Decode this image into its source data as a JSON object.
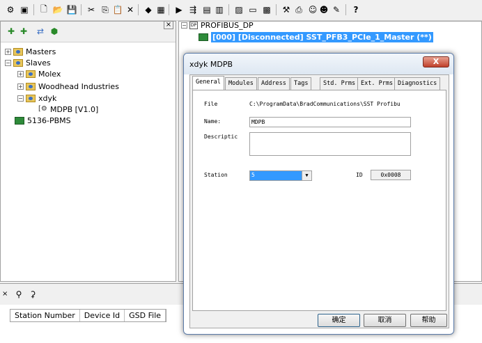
{
  "toolbar": {
    "icons": [
      "network-icon",
      "properties-icon",
      "new-icon",
      "open-icon",
      "save-icon",
      "cut-icon",
      "copy-icon",
      "paste-icon",
      "delete-icon",
      "online-icon",
      "config-icon",
      "download-icon",
      "upload-icon",
      "xml-icon",
      "lsx-icon",
      "monitor-icon",
      "view-icon",
      "device-icon",
      "tool-icon",
      "printer-icon",
      "people-icon",
      "people2-icon",
      "note-icon",
      "help-icon"
    ]
  },
  "left_tree": {
    "masters": "Masters",
    "slaves": "Slaves",
    "molex": "Molex",
    "woodhead": "Woodhead Industries",
    "xdyk": "xdyk",
    "mdpb": "MDPB [V1.0]",
    "pbms": "5136-PBMS"
  },
  "right_tree": {
    "root": "PROFIBUS_DP",
    "master": "[000] [Disconnected] SST_PFB3_PCIe_1_Master (**)"
  },
  "bottom": {
    "close_glyph": "×",
    "columns": [
      "Station Number",
      "Device Id",
      "GSD File"
    ]
  },
  "dialog": {
    "title": "xdyk MDPB",
    "close_label": "X",
    "tabs": [
      "General",
      "Modules",
      "Address",
      "Tags",
      "Std. Prms",
      "Ext. Prms",
      "Diagnostics"
    ],
    "file_label": "File",
    "file_value": "C:\\ProgramData\\BradCommunications\\SST Profibu",
    "name_label": "Name:",
    "name_value": "MDPB",
    "desc_label": "Descriptic",
    "desc_value": "",
    "station_label": "Station",
    "station_value": "5",
    "id_label": "ID",
    "id_value": "0x0008",
    "ok": "确定",
    "cancel": "取消",
    "help": "帮助"
  },
  "left_close": "×"
}
